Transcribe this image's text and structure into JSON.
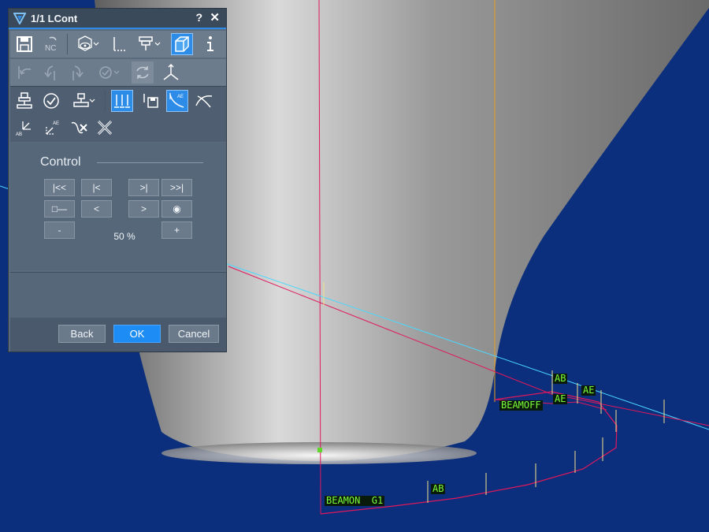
{
  "window": {
    "title": "1/1 LCont",
    "help_label": "?",
    "close_label": "✕"
  },
  "colors": {
    "accent": "#2d8ce8",
    "ok_button": "#1e8cf5",
    "viewport_background": "#0b2f7c",
    "path_line": "#e0185c",
    "tool_axis": "#e8a020",
    "label_text": "#7cff3a"
  },
  "toolbar": {
    "row1": [
      {
        "icon": "save-icon"
      },
      {
        "icon": "nc-icon",
        "text": "NC"
      },
      {
        "icon": "view-eye-icon"
      },
      {
        "icon": "axis-icon"
      },
      {
        "icon": "machine-tool-icon"
      },
      {
        "icon": "cube-icon",
        "active": true
      },
      {
        "icon": "info-icon"
      }
    ],
    "row2": [
      {
        "icon": "undo-path-icon"
      },
      {
        "icon": "rotate-left-icon"
      },
      {
        "icon": "rotate-right-icon"
      },
      {
        "icon": "visibility-check-icon"
      },
      {
        "icon": "refresh-icon"
      },
      {
        "icon": "coordinate-axes-icon"
      }
    ],
    "row3": [
      {
        "icon": "laser-head-icon"
      },
      {
        "icon": "check-circle-icon"
      },
      {
        "icon": "head-dropdown-icon"
      },
      {
        "icon": "multi-beam-icon",
        "active": true
      },
      {
        "icon": "save-head-icon"
      },
      {
        "icon": "path-ae-icon",
        "active": true,
        "text": "AE"
      },
      {
        "icon": "curve-icon"
      }
    ],
    "row4": [
      {
        "icon": "point-ab-icon",
        "text": "AB"
      },
      {
        "icon": "point-ae-icon",
        "text": "AE"
      },
      {
        "icon": "delete-path-icon"
      },
      {
        "icon": "delete-all-icon"
      }
    ]
  },
  "control": {
    "title": "Control",
    "buttons_row1": [
      "|<<",
      "|<",
      ">|",
      ">>|"
    ],
    "buttons_row2": [
      "□—",
      "<",
      ">",
      "◉"
    ],
    "minus_label": "-",
    "plus_label": "+",
    "zoom_value": "50 %"
  },
  "footer": {
    "back_label": "Back",
    "ok_label": "OK",
    "cancel_label": "Cancel"
  },
  "viewport": {
    "labels": {
      "ab1": "AB",
      "ae1": "AE",
      "ae2": "AE",
      "beamoff": "BEAMOFF",
      "beamon": "BEAMON  G1",
      "ab2": "AB"
    }
  }
}
